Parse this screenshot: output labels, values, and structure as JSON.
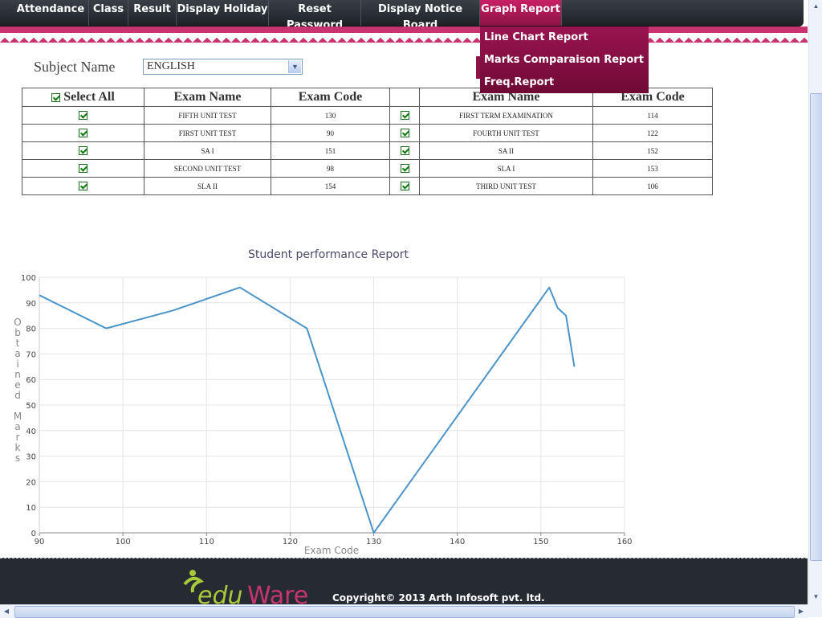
{
  "nav": {
    "items": [
      "Attendance",
      "Class",
      "Result",
      "Display Holiday",
      "Reset Password",
      "Display Notice Board",
      "Graph Report"
    ],
    "active": "Graph Report"
  },
  "dropdown": {
    "items": [
      "Line Chart Report",
      "Marks Comparaison Report",
      "Freq.Report"
    ]
  },
  "subject": {
    "label": "Subject Name",
    "selected": "ENGLISH"
  },
  "exam_table": {
    "headers": [
      "Select All",
      "Exam Name",
      "Exam Code",
      "",
      "Exam Name",
      "Exam Code"
    ],
    "rows": [
      {
        "left_name": "FIFTH UNIT TEST",
        "left_code": "130",
        "right_name": "FIRST TERM EXAMINATION",
        "right_code": "114"
      },
      {
        "left_name": "FIRST UNIT TEST",
        "left_code": "90",
        "right_name": "FOURTH UNIT TEST",
        "right_code": "122"
      },
      {
        "left_name": "SA I",
        "left_code": "151",
        "right_name": "SA II",
        "right_code": "152"
      },
      {
        "left_name": "SECOND UNIT TEST",
        "left_code": "98",
        "right_name": "SLA I",
        "right_code": "153"
      },
      {
        "left_name": "SLA II",
        "left_code": "154",
        "right_name": "THIRD UNIT TEST",
        "right_code": "106"
      }
    ]
  },
  "chart_data": {
    "type": "line",
    "title": "Student performance Report",
    "xlabel": "Exam Code",
    "ylabel": "Obtained Marks",
    "xlim": [
      90,
      160
    ],
    "ylim": [
      0,
      100
    ],
    "xticks": [
      90,
      100,
      110,
      120,
      130,
      140,
      150,
      160
    ],
    "yticks": [
      0,
      10,
      20,
      30,
      40,
      50,
      60,
      70,
      80,
      90,
      100
    ],
    "grid": true,
    "color": "#4a94c8",
    "x": [
      90,
      98,
      106,
      114,
      122,
      130,
      151,
      152,
      153,
      154
    ],
    "y": [
      93,
      80,
      87,
      96,
      80,
      0,
      96,
      88,
      85,
      65
    ]
  },
  "footer": {
    "logo_text": "eduWare",
    "copyright": "Copyright© 2013 Arth Infosoft pvt. ltd."
  },
  "colors": {
    "nav_bg": "#2a2e35",
    "accent": "#c7346f",
    "dropdown_bg": "#7e0e41",
    "footer_bg": "#252a33",
    "logo_green": "#a7c93a"
  }
}
